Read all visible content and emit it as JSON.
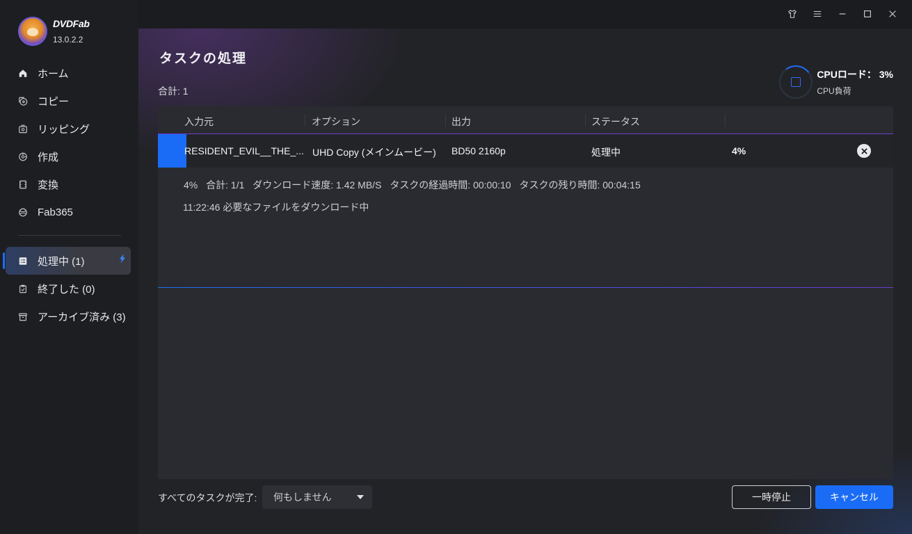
{
  "app": {
    "name": "DVDFab",
    "version": "13.0.2.2"
  },
  "sidebar": {
    "items": [
      {
        "label": "ホーム",
        "icon": "home-icon"
      },
      {
        "label": "コピー",
        "icon": "copy-disc-icon"
      },
      {
        "label": "リッピング",
        "icon": "ripping-icon"
      },
      {
        "label": "作成",
        "icon": "create-icon"
      },
      {
        "label": "変換",
        "icon": "convert-icon"
      },
      {
        "label": "Fab365",
        "icon": "fab365-icon"
      }
    ],
    "queue": [
      {
        "label": "処理中 (1)",
        "icon": "task-list-icon",
        "active": true
      },
      {
        "label": "終了した (0)",
        "icon": "clipboard-check-icon",
        "active": false
      },
      {
        "label": "アーカイブ済み (3)",
        "icon": "archive-icon",
        "active": false
      }
    ]
  },
  "window": {
    "controls": [
      "skin-icon",
      "menu-icon",
      "minimize-icon",
      "maximize-icon",
      "close-icon"
    ]
  },
  "main": {
    "title": "タスクの処理",
    "total": "合計: 1",
    "cpu": {
      "load_label": "CPUロード： 3%",
      "sub_label": "CPU負荷",
      "load_value": 0.03
    },
    "table": {
      "headers": [
        "入力元",
        "オプション",
        "出力",
        "ステータス"
      ],
      "row": {
        "source": "RESIDENT_EVIL__THE_...",
        "option": "UHD Copy (メインムービー)",
        "output": "BD50 2160p",
        "status": "処理中",
        "percent": "4%"
      },
      "detail": {
        "progress": "4%",
        "count": "合計: 1/1",
        "speed": "ダウンロード速度: 1.42 MB/S",
        "elapsed": "タスクの経過時間: 00:00:10",
        "remaining": "タスクの残り時間: 00:04:15",
        "log": "11:22:46  必要なファイルをダウンロード中"
      }
    },
    "footer": {
      "after_label": "すべてのタスクが完了:",
      "after_value": "何もしません",
      "pause_label": "一時停止",
      "cancel_label": "キャンセル"
    }
  },
  "colors": {
    "accent": "#1a6cf6",
    "purple": "#6b3bd0",
    "background": "#222327"
  }
}
